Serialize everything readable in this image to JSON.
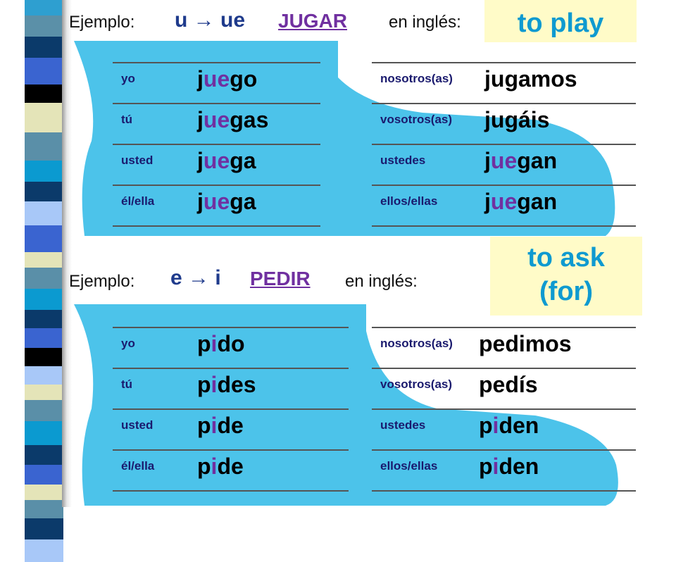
{
  "stripe_colors": [
    "#2e9fd0",
    "#5b90a8",
    "#0b3a6a",
    "#3a64d0",
    "#000000",
    "#e4e4b8",
    "#5a8fa8",
    "#0b9ad0",
    "#0b3a6a",
    "#a8c8f8",
    "#3a64d0",
    "#e4e4b8",
    "#5a8fa8",
    "#0b9ad0",
    "#0b3a6a",
    "#3a64d0",
    "#000000",
    "#a8c8f8",
    "#e4e4b8",
    "#5a8fa8",
    "#0b9ad0",
    "#0b3a6a",
    "#3a64d0",
    "#e4e4b8",
    "#5a8fa8",
    "#0b3a6a",
    "#a8c8f8"
  ],
  "colors": {
    "boot": "#4cc3ea",
    "highlight": "#7030a0",
    "rule": "#1f3b8c",
    "translation": "#0e9ad0",
    "translation_bg": "#fffbc8"
  },
  "example1": {
    "label": "Ejemplo:",
    "rule": "u → ue",
    "infinitive": "JUGAR",
    "en_label": "en inglés:",
    "translation": "to play",
    "left": [
      {
        "p": "yo",
        "v": [
          "j",
          "ue",
          "go"
        ]
      },
      {
        "p": "tú",
        "v": [
          "j",
          "ue",
          "gas"
        ]
      },
      {
        "p": "usted",
        "v": [
          "j",
          "ue",
          "ga"
        ]
      },
      {
        "p": "él/ella",
        "v": [
          "j",
          "ue",
          "ga"
        ]
      }
    ],
    "right": [
      {
        "p": "nosotros(as)",
        "v": [
          "jugamos",
          "",
          ""
        ]
      },
      {
        "p": "vosotros(as)",
        "v": [
          "jugáis",
          "",
          ""
        ]
      },
      {
        "p": "ustedes",
        "v": [
          "j",
          "ue",
          "gan"
        ]
      },
      {
        "p": "ellos/ellas",
        "v": [
          "j",
          "ue",
          "gan"
        ]
      }
    ]
  },
  "example2": {
    "label": "Ejemplo:",
    "rule": "e → i",
    "infinitive": "PEDIR",
    "en_label": "en inglés:",
    "translation_line1": "to ask",
    "translation_line2": "(for)",
    "left": [
      {
        "p": "yo",
        "v": [
          "p",
          "i",
          "do"
        ]
      },
      {
        "p": "tú",
        "v": [
          "p",
          "i",
          "des"
        ]
      },
      {
        "p": "usted",
        "v": [
          "p",
          "i",
          "de"
        ]
      },
      {
        "p": "él/ella",
        "v": [
          "p",
          "i",
          "de"
        ]
      }
    ],
    "right": [
      {
        "p": "nosotros(as)",
        "v": [
          "pedimos",
          "",
          ""
        ]
      },
      {
        "p": "vosotros(as)",
        "v": [
          "pedís",
          "",
          ""
        ]
      },
      {
        "p": "ustedes",
        "v": [
          "p",
          "i",
          "den"
        ]
      },
      {
        "p": "ellos/ellas",
        "v": [
          "p",
          "i",
          "den"
        ]
      }
    ]
  }
}
